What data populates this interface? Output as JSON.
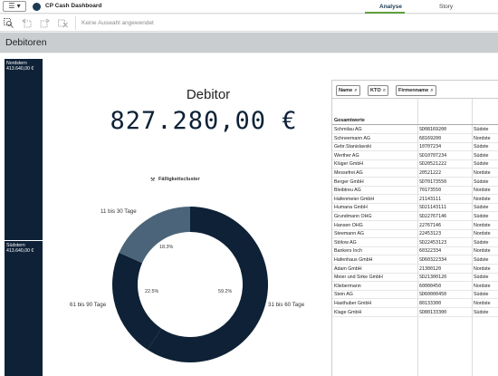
{
  "topbar": {
    "menu_label": "☰ ▾",
    "app_title": "CP Cash Dashboard",
    "tabs": [
      {
        "label": "Analyse"
      },
      {
        "label": "Story"
      }
    ]
  },
  "selection_bar": {
    "text": "Keine Auswahl angewendet"
  },
  "sheet": {
    "title": "Debitoren"
  },
  "regions": [
    {
      "name": "Nordstern",
      "value": "413.640,00 €"
    },
    {
      "name": "Südstern",
      "value": "413.640,00 €"
    }
  ],
  "kpi": {
    "title": "Debitor",
    "value": "827.280,00 €"
  },
  "chart_data": {
    "type": "pie",
    "title": "Fälligkeitscluster",
    "categories": [
      "11 bis 30 Tage",
      "31 bis 60 Tage",
      "61 bis 90 Tage"
    ],
    "values": [
      18.3,
      59.2,
      22.5
    ],
    "value_labels": [
      "18.3%",
      "59.2%",
      "22.5%"
    ],
    "colors": [
      "#4b6479",
      "#0e2136",
      "#0e2136"
    ]
  },
  "table": {
    "headers": [
      {
        "label": "Name",
        "icon": "search-icon"
      },
      {
        "label": "KTO",
        "icon": "search-icon"
      },
      {
        "label": "Firmenname",
        "icon": "search-icon"
      }
    ],
    "totals_label": "Gesamtwerte",
    "rows": [
      {
        "name": "Schmilau AG",
        "kto": "SD08169200",
        "firm": "Südste"
      },
      {
        "name": "Schneemann AG",
        "kto": "68169200",
        "firm": "Nordste"
      },
      {
        "name": "Gebr.Stanislavski",
        "kto": "10707234",
        "firm": "Südste"
      },
      {
        "name": "Werther AG",
        "kto": "SD10707234",
        "firm": "Südste"
      },
      {
        "name": "Klüger GmbH",
        "kto": "SD20521222",
        "firm": "Südste"
      },
      {
        "name": "Messefrei AG",
        "kto": "20521222",
        "firm": "Nordste"
      },
      {
        "name": "Berger GmbH",
        "kto": "SD70173550",
        "firm": "Südste"
      },
      {
        "name": "Bleibtreu AG",
        "kto": "70173550",
        "firm": "Nordste"
      },
      {
        "name": "Hafenmeier GmbH",
        "kto": "21143111",
        "firm": "Nordste"
      },
      {
        "name": "Humana GmbH",
        "kto": "SD21143111",
        "firm": "Südste"
      },
      {
        "name": "Grundmann OHG",
        "kto": "SD22767146",
        "firm": "Südste"
      },
      {
        "name": "Hansen OHG",
        "kto": "22767146",
        "firm": "Nordste"
      },
      {
        "name": "Steemann AG",
        "kto": "22453123",
        "firm": "Nordste"
      },
      {
        "name": "Stölow AG",
        "kto": "SD22453123",
        "firm": "Südste"
      },
      {
        "name": "Bankers Inch",
        "kto": "60322334",
        "firm": "Nordste"
      },
      {
        "name": "Hafenhaus GmbH",
        "kto": "SD60322334",
        "firm": "Südste"
      },
      {
        "name": "Adam GmbH",
        "kto": "21300120",
        "firm": "Nordste"
      },
      {
        "name": "Meier und Sirke GmbH",
        "kto": "SD21300120",
        "firm": "Südste"
      },
      {
        "name": "Kliebermann",
        "kto": "60000450",
        "firm": "Nordste"
      },
      {
        "name": "Stein AG",
        "kto": "SD60000450",
        "firm": "Südste"
      },
      {
        "name": "Hasthuber GmbH",
        "kto": "80133300",
        "firm": "Nordste"
      },
      {
        "name": "Klage GmbH",
        "kto": "SD80133300",
        "firm": "Südste"
      }
    ]
  }
}
